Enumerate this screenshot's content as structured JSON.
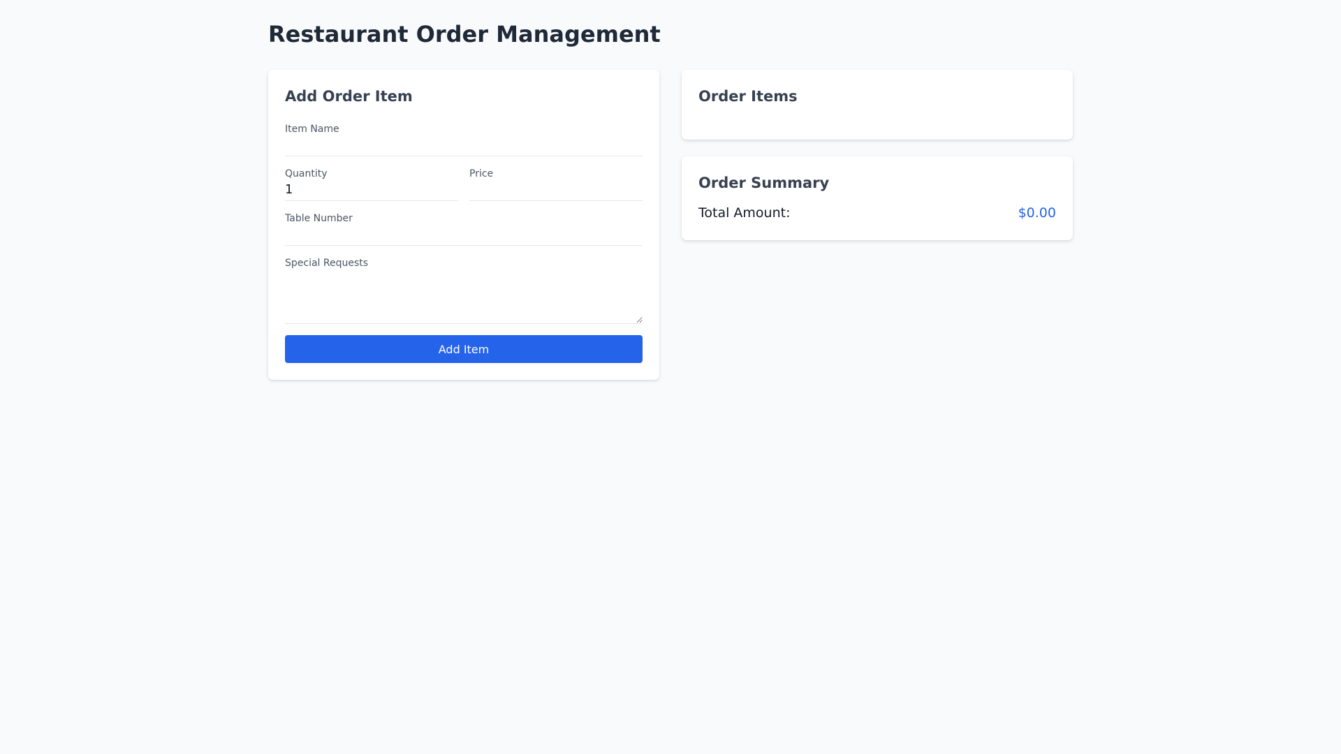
{
  "page": {
    "title": "Restaurant Order Management"
  },
  "add_form": {
    "title": "Add Order Item",
    "item_name_label": "Item Name",
    "item_name_value": "",
    "quantity_label": "Quantity",
    "quantity_value": "1",
    "price_label": "Price",
    "price_value": "",
    "table_number_label": "Table Number",
    "table_number_value": "",
    "special_requests_label": "Special Requests",
    "special_requests_value": "",
    "add_button_label": "Add Item"
  },
  "order_items": {
    "title": "Order Items"
  },
  "order_summary": {
    "title": "Order Summary",
    "total_label": "Total Amount:",
    "total_value": "$0.00"
  },
  "colors": {
    "accent": "#2563eb",
    "background": "#f8fafc",
    "heading": "#1f2937"
  }
}
